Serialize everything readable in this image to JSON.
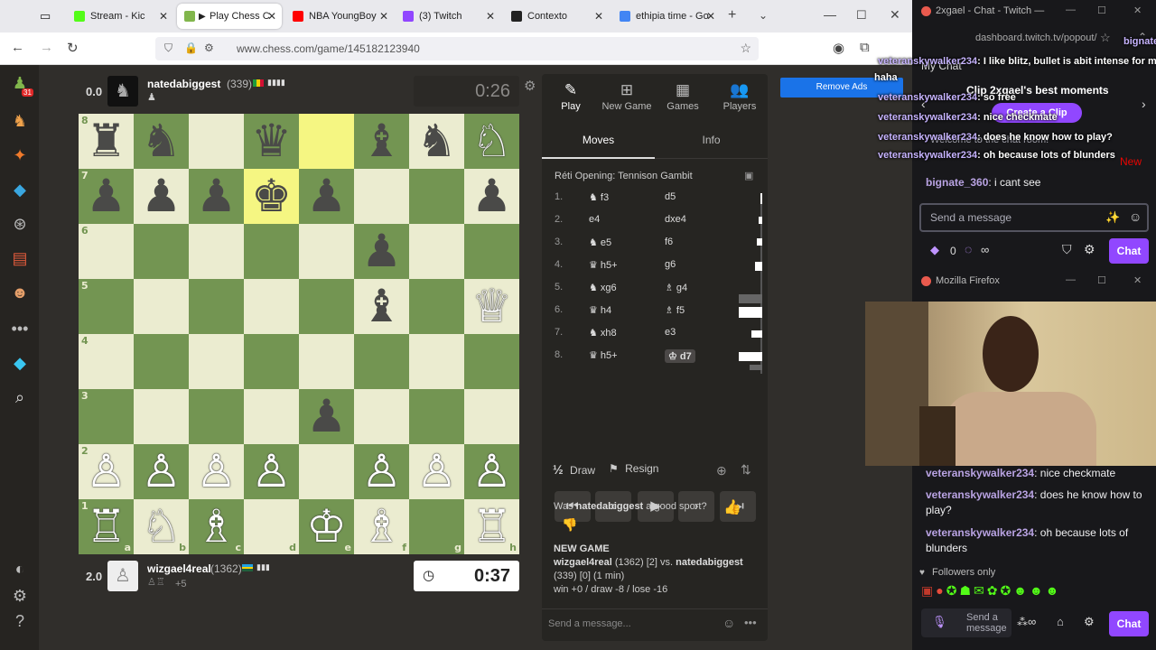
{
  "browser": {
    "tabs": [
      {
        "label": "Stream - Kic",
        "color": "#53fc18"
      },
      {
        "label": "Play Chess C",
        "color": "#81b64c",
        "active": true
      },
      {
        "label": "NBA YoungBoy",
        "color": "#ff0000"
      },
      {
        "label": "(3) Twitch",
        "color": "#9146ff"
      },
      {
        "label": "Contexto",
        "color": "#222222"
      },
      {
        "label": "ethipia time - Go",
        "color": "#4285f4"
      }
    ],
    "url": "www.chess.com/game/145182123940"
  },
  "top_player": {
    "eval": "0.0",
    "name": "natedabiggest",
    "rating": "(339)",
    "clock": "0:26"
  },
  "bottom_player": {
    "eval": "2.0",
    "name": "wizgael4real",
    "rating": "(1362)",
    "captured": "+5",
    "clock": "0:37"
  },
  "board": {
    "ranks": [
      "8",
      "7",
      "6",
      "5",
      "4",
      "3",
      "2",
      "1"
    ],
    "files": [
      "a",
      "b",
      "c",
      "d",
      "e",
      "f",
      "g",
      "h"
    ],
    "rows": [
      [
        "♜",
        "♞",
        "",
        "♛",
        "",
        "♝",
        "♞",
        "♘"
      ],
      [
        "♟",
        "♟",
        "♟",
        "♚",
        "♟",
        "",
        "",
        "♟"
      ],
      [
        "",
        "",
        "",
        "",
        "",
        "♟",
        "",
        ""
      ],
      [
        "",
        "",
        "",
        "",
        "",
        "♝",
        "",
        "♕"
      ],
      [
        "",
        "",
        "",
        "",
        "",
        "",
        "",
        ""
      ],
      [
        "",
        "",
        "",
        "",
        "♟",
        "",
        "",
        ""
      ],
      [
        "♙",
        "♙",
        "♙",
        "♙",
        "",
        "♙",
        "♙",
        "♙"
      ],
      [
        "♖",
        "♘",
        "♗",
        "",
        "♔",
        "♗",
        "",
        "♖"
      ]
    ],
    "colors": [
      [
        "b",
        "b",
        "",
        "b",
        "",
        "b",
        "b",
        "w"
      ],
      [
        "b",
        "b",
        "b",
        "b",
        "b",
        "",
        "",
        "b"
      ],
      [
        "",
        "",
        "",
        "",
        "",
        "b",
        "",
        ""
      ],
      [
        "",
        "",
        "",
        "",
        "",
        "b",
        "",
        "w"
      ],
      [
        "",
        "",
        "",
        "",
        "",
        "",
        "",
        ""
      ],
      [
        "",
        "",
        "",
        "",
        "b",
        "",
        "",
        ""
      ],
      [
        "w",
        "w",
        "w",
        "w",
        "",
        "w",
        "w",
        "w"
      ],
      [
        "w",
        "w",
        "w",
        "",
        "w",
        "w",
        "",
        "w"
      ]
    ],
    "highlight_color": "#f5f682"
  },
  "panel": {
    "nav": [
      {
        "label": "Play",
        "icon": "✎"
      },
      {
        "label": "New Game",
        "icon": "⊞"
      },
      {
        "label": "Games",
        "icon": "▦"
      },
      {
        "label": "Players",
        "icon": "👥"
      }
    ],
    "tabs": [
      "Moves",
      "Info"
    ],
    "opening": "Réti Opening: Tennison Gambit",
    "moves": [
      {
        "n": "1.",
        "w": "♞ f3",
        "b": "d5"
      },
      {
        "n": "2.",
        "w": "e4",
        "b": "dxe4"
      },
      {
        "n": "3.",
        "w": "♞ e5",
        "b": "f6"
      },
      {
        "n": "4.",
        "w": "♛ h5+",
        "b": "g6"
      },
      {
        "n": "5.",
        "w": "♞ xg6",
        "b": "♗ g4"
      },
      {
        "n": "6.",
        "w": "♛ h4",
        "b": "♗ f5"
      },
      {
        "n": "7.",
        "w": "♞ xh8",
        "b": "e3"
      },
      {
        "n": "8.",
        "w": "♛ h5+",
        "b": "♔ d7"
      }
    ],
    "draw_label": "Draw",
    "draw_icon": "½",
    "resign_label": "Resign",
    "sport_prefix": "Was",
    "sport_name": "natedabiggest",
    "sport_suffix": "a good sport?",
    "new_game_heading": "NEW GAME",
    "game_line1": "wizgael4real",
    "game_line1b": "(1362) [2] vs.",
    "game_line1c": "natedabiggest",
    "game_line2": "(339) [0] (1 min)",
    "result_line": "win +0 / draw -8 / lose -16",
    "message_placeholder": "Send a message..."
  },
  "remove_ads": "Remove Ads",
  "twitch": {
    "window_title": "2xgael - Chat - Twitch —",
    "url_fragment": "dashboard.twitch.tv/popout/",
    "my_chat": "My Chat",
    "clip_title": "Clip 2xgael's best moments",
    "create_clip": "Create a Clip",
    "welcome": "Welcome to the chat room!",
    "new_label": "New",
    "send_placeholder": "Send a message",
    "points": "0",
    "chat_button": "Chat",
    "firefox_title": "Mozilla Firefox",
    "followers_only": "Followers only",
    "send_short": "Send a message",
    "messages": [
      {
        "user": "veteranskywalker234",
        "text": "nice checkmate"
      },
      {
        "user": "veteranskywalker234",
        "text": "does he know how to play?"
      },
      {
        "user": "veteranskywalker234",
        "text": "oh because lots of blunders"
      }
    ],
    "bottom_user": "bignate_360",
    "bottom_text": "i cant see"
  },
  "overlay": {
    "lines": [
      {
        "user": "bignate_360",
        "text": ""
      },
      {
        "user": "",
        "text": "haha"
      },
      {
        "user": "veteranskywalker234",
        "text": ": I like blitz, bullet is abit intense for me"
      },
      {
        "user": "veteranskywalker234",
        "text": ": so free"
      },
      {
        "user": "veteranskywalker234",
        "text": ": nice checkmate"
      },
      {
        "user": "veteranskywalker234",
        "text": ": does he know how to play?"
      },
      {
        "user": "veteranskywalker234",
        "text": ": oh because lots of blunders"
      }
    ]
  }
}
